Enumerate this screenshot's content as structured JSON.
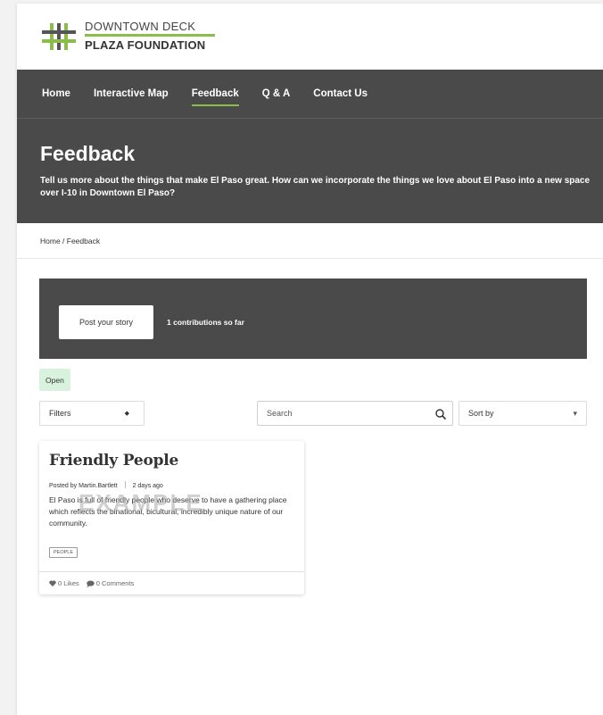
{
  "brand": {
    "line1": "DOWNTOWN DECK",
    "line2": "PLAZA FOUNDATION",
    "accent": "#8bbd4a",
    "dark": "#4a4a4a"
  },
  "nav": {
    "items": [
      {
        "label": "Home"
      },
      {
        "label": "Interactive Map"
      },
      {
        "label": "Feedback",
        "active": true
      },
      {
        "label": "Q & A"
      },
      {
        "label": "Contact Us"
      }
    ]
  },
  "hero": {
    "title": "Feedback",
    "description": "Tell us more about the things that make El Paso great. How can we incorporate the things we love about El Paso into a new space over I-10 in Downtown El Paso?"
  },
  "breadcrumb": "Home / Feedback",
  "banner": {
    "post_button": "Post your story",
    "contributions": "1 contributions so far"
  },
  "status_badge": "Open",
  "toolbar": {
    "filters_label": "Filters",
    "search_placeholder": "Search",
    "sort_label": "Sort by"
  },
  "story": {
    "title": "Friendly People",
    "author_prefix": "Posted by",
    "author": "Martin.Bartlett",
    "time": "2 days ago",
    "body": "El Paso is full of friendly people who deserve to have a gathering place which reflects the binational, bicultural, incredibly unique nature of our community.",
    "watermark": "EXAMPLE",
    "tag": "PEOPLE",
    "likes": "0 Likes",
    "comments": "0 Comments"
  },
  "icons": {
    "search": "search-icon",
    "heart": "heart-icon",
    "comment": "comment-icon",
    "logo": "hash-logo-icon"
  }
}
